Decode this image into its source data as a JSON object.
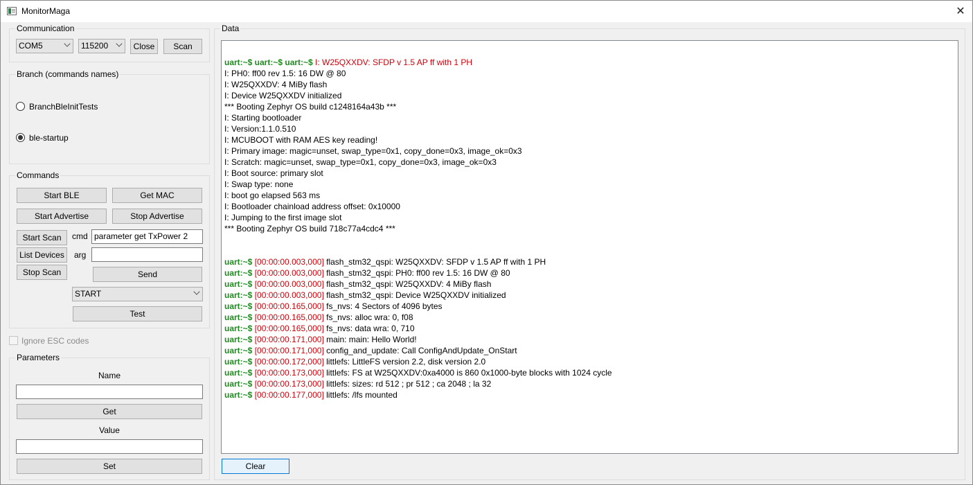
{
  "window": {
    "title": "MonitorMaga",
    "close_glyph": "✕"
  },
  "communication": {
    "legend": "Communication",
    "port": "COM5",
    "baud": "115200",
    "close_label": "Close",
    "scan_label": "Scan"
  },
  "branch": {
    "legend": "Branch (commands names)",
    "options": [
      {
        "label": "BranchBleInitTests",
        "checked": false
      },
      {
        "label": "ble-startup",
        "checked": true
      }
    ]
  },
  "commands": {
    "legend": "Commands",
    "start_ble": "Start BLE",
    "get_mac": "Get MAC",
    "start_advertise": "Start Advertise",
    "stop_advertise": "Stop Advertise",
    "start_scan": "Start Scan",
    "list_devices": "List Devices",
    "stop_scan": "Stop Scan",
    "cmd_label": "cmd",
    "cmd_value": "parameter get TxPower 2",
    "arg_label": "arg",
    "arg_value": "",
    "send_label": "Send",
    "select_value": "START",
    "test_label": "Test"
  },
  "ignore_esc": {
    "label": "Ignore ESC codes",
    "checked": false
  },
  "parameters": {
    "legend": "Parameters",
    "name_label": "Name",
    "name_value": "",
    "get_label": "Get",
    "value_label": "Value",
    "value_value": "",
    "set_label": "Set"
  },
  "data": {
    "legend": "Data",
    "clear_label": "Clear",
    "first_line": {
      "prompt": "uart:~$ uart:~$ uart:~$ ",
      "text": "I: W25QXXDV: SFDP v 1.5 AP ff with 1 PH"
    },
    "boot_lines": [
      "I: PH0: ff00 rev 1.5: 16 DW @ 80",
      "I: W25QXXDV: 4 MiBy flash",
      "I: Device W25QXXDV initialized",
      "*** Booting Zephyr OS build c1248164a43b ***",
      "I: Starting bootloader",
      "I: Version:1.1.0.510",
      "I: MCUBOOT with RAM AES key reading!",
      "I: Primary image: magic=unset, swap_type=0x1, copy_done=0x3, image_ok=0x3",
      "I: Scratch: magic=unset, swap_type=0x1, copy_done=0x3, image_ok=0x3",
      "I: Boot source: primary slot",
      "I: Swap type: none",
      "I: boot go elapsed 563 ms",
      "I: Bootloader chainload address offset: 0x10000",
      "I: Jumping to the first image slot",
      "*** Booting Zephyr OS build 718c77a4cdc4 ***"
    ],
    "log_lines": [
      {
        "prompt": "uart:~$ ",
        "ts": "[00:00:00.003,000]",
        "text": " flash_stm32_qspi: W25QXXDV: SFDP v 1.5 AP ff with 1 PH"
      },
      {
        "prompt": "uart:~$ ",
        "ts": "[00:00:00.003,000]",
        "text": " flash_stm32_qspi: PH0: ff00 rev 1.5: 16 DW @ 80"
      },
      {
        "prompt": "uart:~$ ",
        "ts": "[00:00:00.003,000]",
        "text": " flash_stm32_qspi: W25QXXDV: 4 MiBy flash"
      },
      {
        "prompt": "uart:~$ ",
        "ts": "[00:00:00.003,000]",
        "text": " flash_stm32_qspi: Device W25QXXDV initialized"
      },
      {
        "prompt": "uart:~$ ",
        "ts": "[00:00:00.165,000]",
        "text": " fs_nvs: 4 Sectors of 4096 bytes"
      },
      {
        "prompt": "uart:~$ ",
        "ts": "[00:00:00.165,000]",
        "text": " fs_nvs: alloc wra: 0, f08"
      },
      {
        "prompt": "uart:~$ ",
        "ts": "[00:00:00.165,000]",
        "text": " fs_nvs: data wra: 0, 710"
      },
      {
        "prompt": "uart:~$ ",
        "ts": "[00:00:00.171,000]",
        "text": " main: main: Hello World!"
      },
      {
        "prompt": "uart:~$ ",
        "ts": "[00:00:00.171,000]",
        "text": " config_and_update: Call ConfigAndUpdate_OnStart"
      },
      {
        "prompt": "uart:~$ ",
        "ts": "[00:00:00.172,000]",
        "text": " littlefs: LittleFS version 2.2, disk version 2.0"
      },
      {
        "prompt": "uart:~$ ",
        "ts": "[00:00:00.173,000]",
        "text": " littlefs: FS at W25QXXDV:0xa4000 is 860 0x1000-byte blocks with 1024 cycle"
      },
      {
        "prompt": "uart:~$ ",
        "ts": "[00:00:00.173,000]",
        "text": " littlefs: sizes: rd 512 ; pr 512 ; ca 2048 ; la 32"
      },
      {
        "prompt": "uart:~$ ",
        "ts": "[00:00:00.177,000]",
        "text": " littlefs: /lfs mounted"
      }
    ]
  },
  "colors": {
    "prompt": "#1f8a1f",
    "timestamp": "#d0000a",
    "accent": "#0078d7"
  }
}
